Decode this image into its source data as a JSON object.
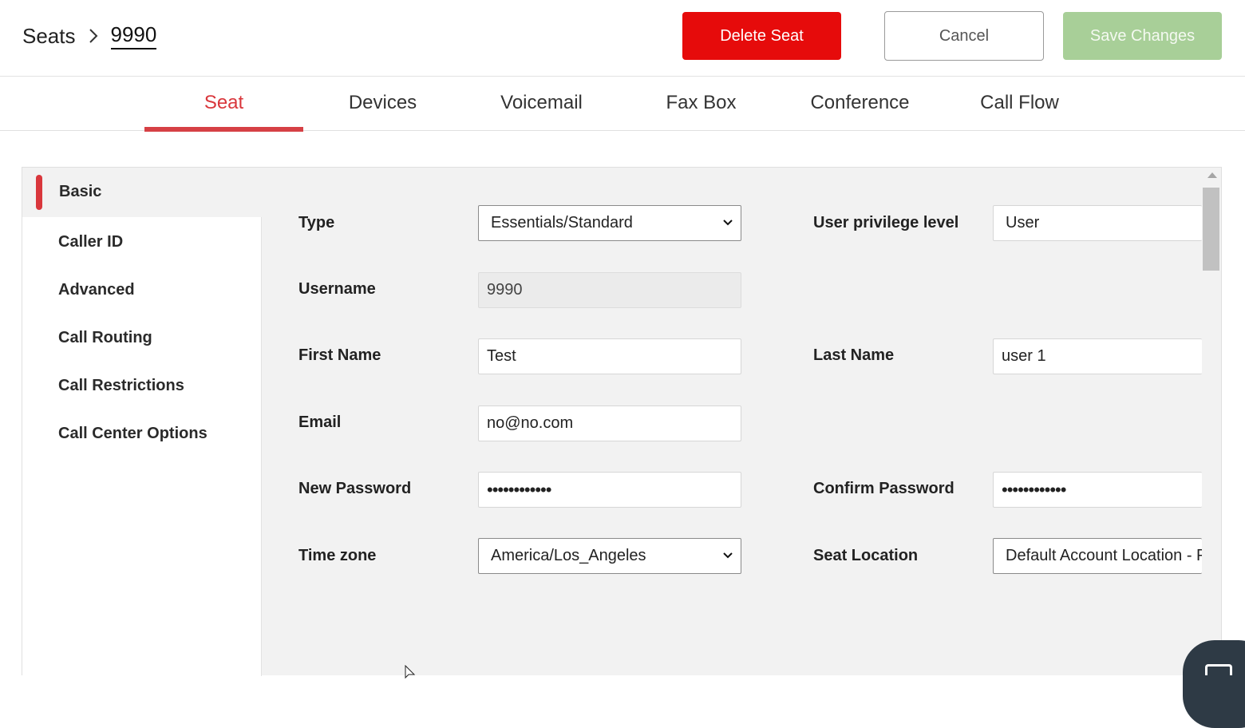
{
  "breadcrumb": {
    "root": "Seats",
    "current": "9990"
  },
  "buttons": {
    "delete": "Delete Seat",
    "cancel": "Cancel",
    "save": "Save Changes"
  },
  "tabs": [
    "Seat",
    "Devices",
    "Voicemail",
    "Fax Box",
    "Conference",
    "Call Flow"
  ],
  "active_tab": "Seat",
  "sidemenu": {
    "active": "Basic",
    "items": [
      "Caller ID",
      "Advanced",
      "Call Routing",
      "Call Restrictions",
      "Call Center Options"
    ]
  },
  "form": {
    "type": {
      "label": "Type",
      "value": "Essentials/Standard"
    },
    "privilege": {
      "label": "User privilege level",
      "value": "User"
    },
    "username": {
      "label": "Username",
      "value": "9990"
    },
    "first_name": {
      "label": "First Name",
      "value": "Test"
    },
    "last_name": {
      "label": "Last Name",
      "value": "user 1"
    },
    "email": {
      "label": "Email",
      "value": "no@no.com"
    },
    "new_password": {
      "label": "New Password",
      "value": "••••••••••••"
    },
    "confirm_password": {
      "label": "Confirm Password",
      "value": "••••••••••••"
    },
    "timezone": {
      "label": "Time zone",
      "value": "America/Los_Angeles"
    },
    "seat_location": {
      "label": "Seat Location",
      "value": "Default Account Location - P"
    }
  },
  "colors": {
    "accent": "#d9373c",
    "delete": "#e60b0b",
    "save_disabled": "#a8cf98",
    "chat": "#2e3a45"
  },
  "icons": [
    "chevron-right-icon",
    "chevron-down-icon",
    "chat-icon",
    "mouse-cursor-icon"
  ]
}
